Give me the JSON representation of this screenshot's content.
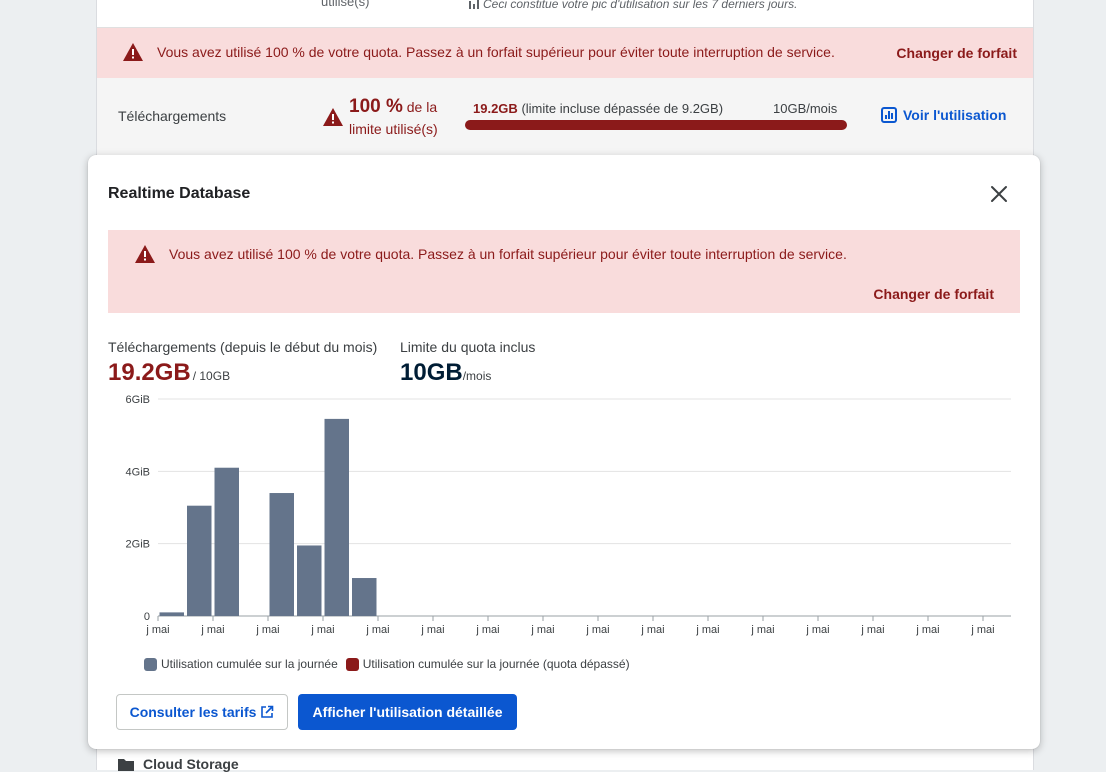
{
  "background": {
    "top_row": {
      "usage_tail": "utilisé(s)",
      "peak_note": "Ceci constitue votre pic d'utilisation sur les 7 derniers jours."
    },
    "alert": {
      "message": "Vous avez utilisé 100 % de votre quota. Passez à un forfait supérieur pour éviter toute interruption de service.",
      "action": "Changer de forfait"
    },
    "downloads_row": {
      "label": "Téléchargements",
      "percent": "100 %",
      "percent_suffix": "de la limite utilisé(s)",
      "used": "19.2GB",
      "used_detail": "(limite incluse dépassée de 9.2GB)",
      "limit": "10GB/mois",
      "progress_fraction": 1.0,
      "view_usage": "Voir l'utilisation"
    },
    "next_section": "Cloud Storage"
  },
  "modal": {
    "title": "Realtime Database",
    "alert": {
      "message": "Vous avez utilisé 100 % de votre quota. Passez à un forfait supérieur pour éviter toute interruption de service.",
      "action": "Changer de forfait"
    },
    "stat_downloads": {
      "label": "Téléchargements (depuis le début du mois)",
      "value": "19.2GB",
      "of": "/ 10GB"
    },
    "stat_limit": {
      "label": "Limite du quota inclus",
      "value": "10GB",
      "unit": "/mois"
    },
    "legend": {
      "normal": "Utilisation cumulée sur la journée",
      "exceeded": "Utilisation cumulée sur la journée (quota dépassé)"
    },
    "buttons": {
      "pricing": "Consulter les tarifs",
      "details": "Afficher l'utilisation détaillée"
    }
  },
  "colors": {
    "normal_bar": "#64748b",
    "exceeded_bar": "#8b1a1a",
    "alert_bg": "#f9dcdc",
    "alert_text": "#8b1a1a",
    "primary": "#0b57d0"
  },
  "chart_data": {
    "type": "bar",
    "ylim": [
      0,
      6
    ],
    "y_ticks": [
      "0",
      "2GiB",
      "4GiB",
      "6GiB"
    ],
    "y_tick_values": [
      0,
      2,
      4,
      6
    ],
    "x_tick_labels": [
      "j mai",
      "j mai",
      "j mai",
      "j mai",
      "j mai",
      "j mai",
      "j mai",
      "j mai",
      "j mai",
      "j mai",
      "j mai",
      "j mai",
      "j mai",
      "j mai",
      "j mai",
      "j mai"
    ],
    "series": [
      {
        "values": [
          0.1,
          3.05,
          4.1,
          0,
          3.4,
          1.95,
          5.45,
          1.05,
          0,
          0,
          0,
          0,
          0,
          0,
          0,
          0,
          0,
          0,
          0,
          0,
          0,
          0,
          0,
          0,
          0,
          0,
          0,
          0,
          0,
          0,
          0
        ]
      }
    ],
    "legend": [
      "Utilisation cumulée sur la journée",
      "Utilisation cumulée sur la journée (quota dépassé)"
    ],
    "grid": true,
    "legend_position": "bottom-left"
  }
}
